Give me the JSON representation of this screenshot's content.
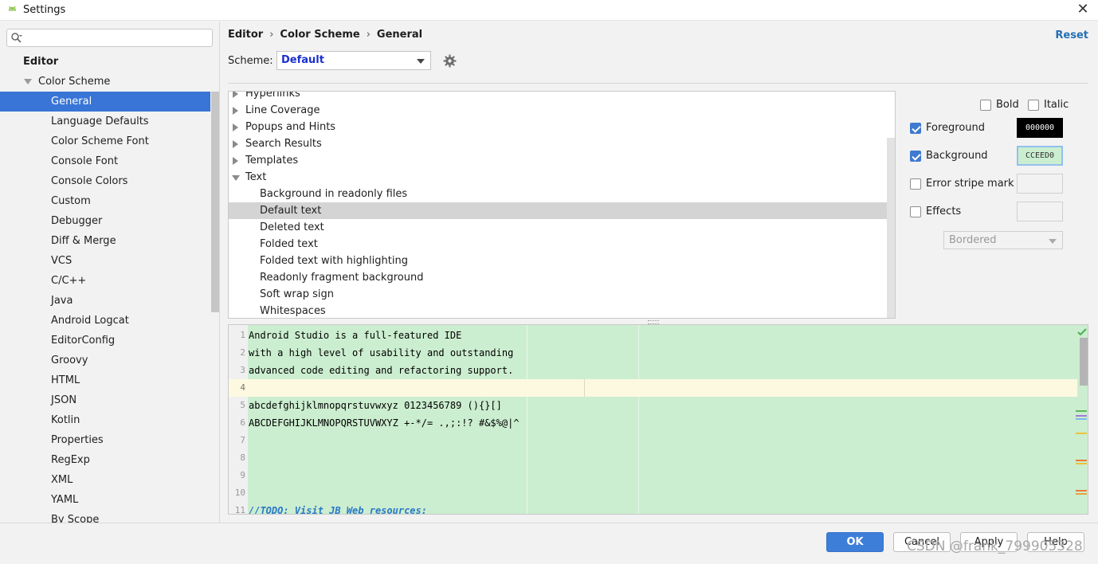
{
  "window": {
    "title": "Settings",
    "close_glyph": "✕"
  },
  "colors": {
    "accent": "#3875d6",
    "preview_background": "#cceed0",
    "caret_row": "#fcf9e0",
    "link": "#2470b3"
  },
  "sidebar": {
    "search_placeholder": "",
    "items": [
      {
        "label": "Editor",
        "level": 0
      },
      {
        "label": "Color Scheme",
        "level": 1,
        "expanded": true
      },
      {
        "label": "General",
        "level": 2,
        "selected": true
      },
      {
        "label": "Language Defaults",
        "level": 2
      },
      {
        "label": "Color Scheme Font",
        "level": 2
      },
      {
        "label": "Console Font",
        "level": 2
      },
      {
        "label": "Console Colors",
        "level": 2
      },
      {
        "label": "Custom",
        "level": 2
      },
      {
        "label": "Debugger",
        "level": 2
      },
      {
        "label": "Diff & Merge",
        "level": 2
      },
      {
        "label": "VCS",
        "level": 2
      },
      {
        "label": "C/C++",
        "level": 2
      },
      {
        "label": "Java",
        "level": 2
      },
      {
        "label": "Android Logcat",
        "level": 2
      },
      {
        "label": "EditorConfig",
        "level": 2
      },
      {
        "label": "Groovy",
        "level": 2
      },
      {
        "label": "HTML",
        "level": 2
      },
      {
        "label": "JSON",
        "level": 2
      },
      {
        "label": "Kotlin",
        "level": 2
      },
      {
        "label": "Properties",
        "level": 2
      },
      {
        "label": "RegExp",
        "level": 2
      },
      {
        "label": "XML",
        "level": 2
      },
      {
        "label": "YAML",
        "level": 2
      },
      {
        "label": "By Scope",
        "level": 2
      }
    ]
  },
  "header": {
    "breadcrumb": [
      "Editor",
      "Color Scheme",
      "General"
    ],
    "separator": "›",
    "reset_label": "Reset"
  },
  "scheme": {
    "label": "Scheme:",
    "value": "Default"
  },
  "options_tree": [
    {
      "label": "Hyperlinks",
      "level": 1,
      "expandable": true,
      "expanded": false
    },
    {
      "label": "Line Coverage",
      "level": 1,
      "expandable": true,
      "expanded": false
    },
    {
      "label": "Popups and Hints",
      "level": 1,
      "expandable": true,
      "expanded": false
    },
    {
      "label": "Search Results",
      "level": 1,
      "expandable": true,
      "expanded": false
    },
    {
      "label": "Templates",
      "level": 1,
      "expandable": true,
      "expanded": false
    },
    {
      "label": "Text",
      "level": 1,
      "expandable": true,
      "expanded": true
    },
    {
      "label": "Background in readonly files",
      "level": 2
    },
    {
      "label": "Default text",
      "level": 2,
      "selected": true
    },
    {
      "label": "Deleted text",
      "level": 2
    },
    {
      "label": "Folded text",
      "level": 2
    },
    {
      "label": "Folded text with highlighting",
      "level": 2
    },
    {
      "label": "Readonly fragment background",
      "level": 2
    },
    {
      "label": "Soft wrap sign",
      "level": 2
    },
    {
      "label": "Whitespaces",
      "level": 2
    }
  ],
  "attributes": {
    "bold_label": "Bold",
    "bold_checked": false,
    "italic_label": "Italic",
    "italic_checked": false,
    "foreground_label": "Foreground",
    "foreground_checked": true,
    "foreground_value": "000000",
    "background_label": "Background",
    "background_checked": true,
    "background_value": "CCEED0",
    "error_stripe_label": "Error stripe mark",
    "error_stripe_checked": false,
    "effects_label": "Effects",
    "effects_checked": false,
    "effects_type": "Bordered"
  },
  "preview": {
    "lines": [
      {
        "n": "1",
        "text": "Android Studio is a full-featured IDE"
      },
      {
        "n": "2",
        "text": "with a high level of usability and outstanding"
      },
      {
        "n": "3",
        "text": "advanced code editing and refactoring support."
      },
      {
        "n": "4",
        "text": "",
        "caret": true
      },
      {
        "n": "5",
        "text": "abcdefghijklmnopqrstuvwxyz 0123456789 (){}[]"
      },
      {
        "n": "6",
        "text": "ABCDEFGHIJKLMNOPQRSTUVWXYZ +-*/= .,;:!? #&$%@|^"
      },
      {
        "n": "7",
        "text": ""
      },
      {
        "n": "8",
        "text": ""
      },
      {
        "n": "9",
        "text": ""
      },
      {
        "n": "10",
        "text": ""
      },
      {
        "n": "11",
        "text": "//TODO: Visit JB Web resources:",
        "todo": true
      }
    ],
    "stripe_marks": [
      "#5cb85c",
      "#a07cd6",
      "#7fb7e8",
      "#e8c23c",
      "#e87c3c",
      "#e8c23c",
      "#e87c3c",
      "#e8a23c"
    ]
  },
  "footer": {
    "ok_label": "OK",
    "cancel_label": "Cancel",
    "apply_label": "Apply",
    "help_label": "Help",
    "watermark": "CSDN @frank_799905328"
  }
}
